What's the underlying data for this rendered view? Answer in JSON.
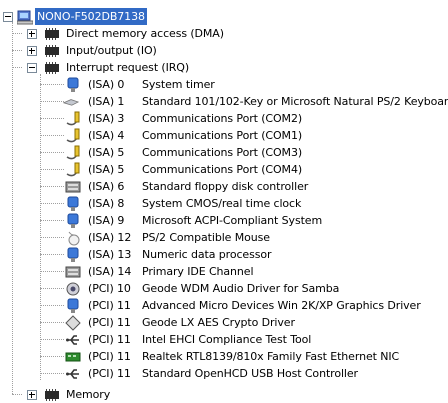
{
  "root": {
    "label": "NONO-F502DB7138",
    "icon": "computer-icon"
  },
  "categories": [
    {
      "label": "Direct memory access (DMA)",
      "expanded": false,
      "icon": "device-category-icon"
    },
    {
      "label": "Input/output (IO)",
      "expanded": false,
      "icon": "device-category-icon"
    },
    {
      "label": "Interrupt request (IRQ)",
      "expanded": true,
      "icon": "device-category-icon"
    },
    {
      "label": "Memory",
      "expanded": false,
      "icon": "device-category-icon"
    }
  ],
  "irq_items": [
    {
      "resource": "(ISA) 0",
      "name": "System timer",
      "icon": "system-device-icon"
    },
    {
      "resource": "(ISA) 1",
      "name": "Standard 101/102-Key or Microsoft Natural PS/2 Keyboard",
      "icon": "keyboard-icon"
    },
    {
      "resource": "(ISA) 3",
      "name": "Communications Port (COM2)",
      "icon": "port-icon"
    },
    {
      "resource": "(ISA) 4",
      "name": "Communications Port (COM1)",
      "icon": "port-icon"
    },
    {
      "resource": "(ISA) 5",
      "name": "Communications Port (COM3)",
      "icon": "port-icon"
    },
    {
      "resource": "(ISA) 5",
      "name": "Communications Port (COM4)",
      "icon": "port-icon"
    },
    {
      "resource": "(ISA) 6",
      "name": "Standard floppy disk controller",
      "icon": "disk-controller-icon"
    },
    {
      "resource": "(ISA) 8",
      "name": "System CMOS/real time clock",
      "icon": "system-device-icon"
    },
    {
      "resource": "(ISA) 9",
      "name": "Microsoft ACPI-Compliant System",
      "icon": "system-device-icon"
    },
    {
      "resource": "(ISA) 12",
      "name": "PS/2 Compatible Mouse",
      "icon": "mouse-icon"
    },
    {
      "resource": "(ISA) 13",
      "name": "Numeric data processor",
      "icon": "system-device-icon"
    },
    {
      "resource": "(ISA) 14",
      "name": "Primary IDE Channel",
      "icon": "disk-controller-icon"
    },
    {
      "resource": "(PCI) 10",
      "name": "Geode WDM Audio Driver for Samba",
      "icon": "audio-icon"
    },
    {
      "resource": "(PCI) 11",
      "name": "Advanced Micro Devices Win 2K/XP Graphics Driver",
      "icon": "display-adapter-icon"
    },
    {
      "resource": "(PCI) 11",
      "name": "Geode LX AES Crypto Driver",
      "icon": "crypto-device-icon"
    },
    {
      "resource": "(PCI) 11",
      "name": "Intel EHCI Compliance Test Tool",
      "icon": "usb-icon"
    },
    {
      "resource": "(PCI) 11",
      "name": "Realtek RTL8139/810x Family Fast Ethernet NIC",
      "icon": "network-adapter-icon"
    },
    {
      "resource": "(PCI) 11",
      "name": "Standard OpenHCD USB Host Controller",
      "icon": "usb-icon"
    }
  ]
}
